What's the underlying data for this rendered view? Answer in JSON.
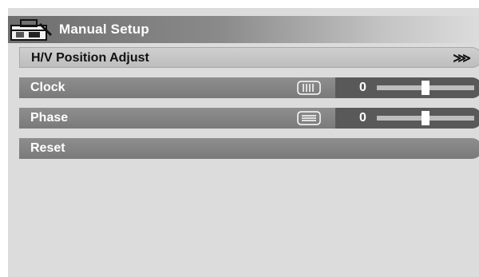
{
  "header": {
    "title": "Manual Setup",
    "icon": "toolbox-icon"
  },
  "menu": {
    "hv_position": {
      "label": "H/V Position Adjust",
      "arrow": "⋙"
    },
    "clock": {
      "label": "Clock",
      "icon": "clock-adjust-icon",
      "value": "0",
      "level": 0.5
    },
    "phase": {
      "label": "Phase",
      "icon": "phase-adjust-icon",
      "value": "0",
      "level": 0.5
    },
    "reset": {
      "label": "Reset"
    }
  },
  "colors": {
    "background": "#dcdcdc",
    "highlight_row": "#c8c8c8",
    "row": "#848484",
    "slider_panel": "#595959"
  }
}
